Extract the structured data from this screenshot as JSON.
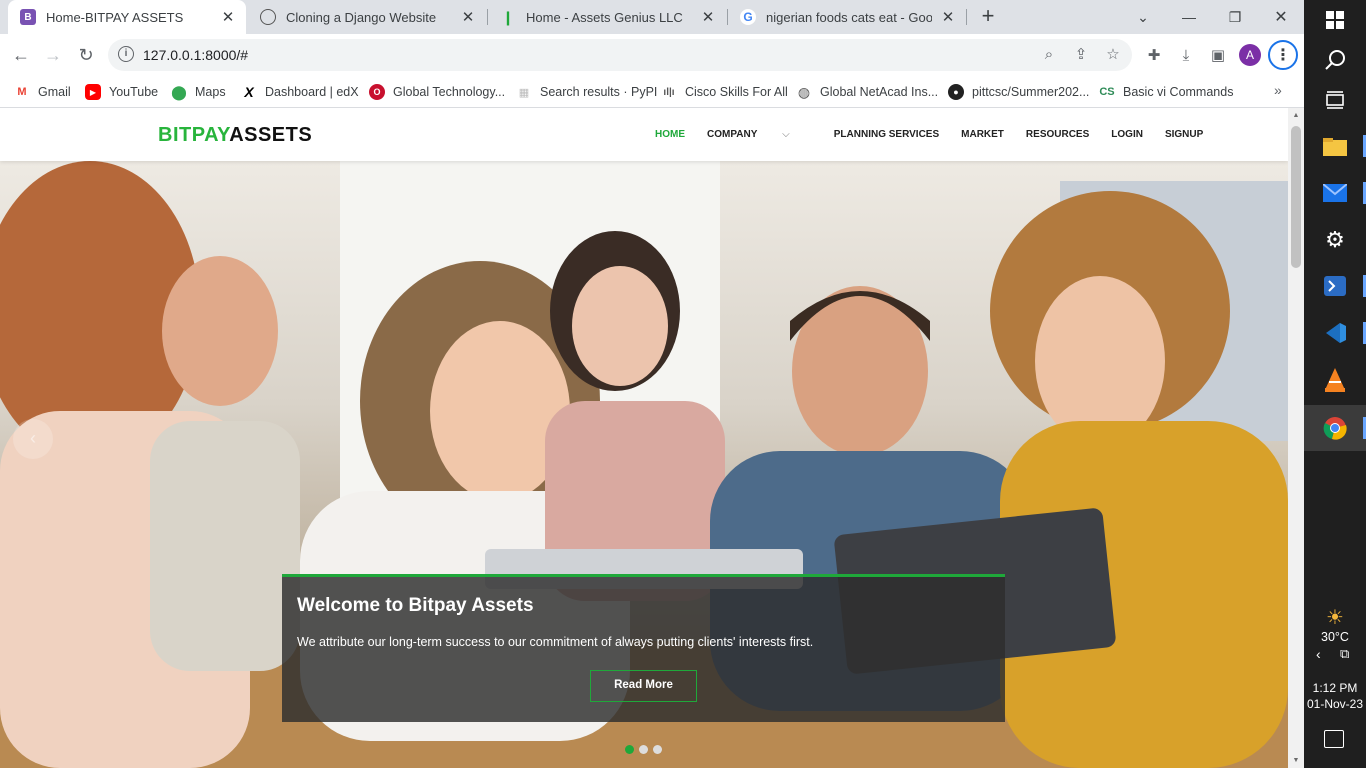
{
  "browser": {
    "tabs": [
      {
        "title": "Home-BITPAY ASSETS",
        "icon": "bootstrap-icon",
        "active": true
      },
      {
        "title": "Cloning a Django Website",
        "icon": "chatgpt-icon",
        "active": false
      },
      {
        "title": "Home - Assets Genius LLC",
        "icon": "green-leaf-icon",
        "active": false
      },
      {
        "title": "nigerian foods cats eat - Google",
        "icon": "google-icon",
        "active": false
      }
    ],
    "url": "127.0.0.1:8000/#",
    "profile_initial": "A",
    "bookmarks": [
      {
        "label": "Gmail",
        "icon": "gmail-icon"
      },
      {
        "label": "YouTube",
        "icon": "youtube-icon"
      },
      {
        "label": "Maps",
        "icon": "maps-icon"
      },
      {
        "label": "Dashboard | edX",
        "icon": "edx-icon"
      },
      {
        "label": "Global Technology...",
        "icon": "opera-icon"
      },
      {
        "label": "Search results · PyPI",
        "icon": "pypi-icon"
      },
      {
        "label": "Cisco Skills For All",
        "icon": "cisco-icon"
      },
      {
        "label": "Global NetAcad Ins...",
        "icon": "globe-icon"
      },
      {
        "label": "pittcsc/Summer202...",
        "icon": "github-icon"
      },
      {
        "label": "Basic vi Commands",
        "icon": "cs-icon"
      }
    ]
  },
  "site": {
    "brand_part1": "BITPAY",
    "brand_part2": "ASSETS",
    "brand_color": "#28b43c",
    "nav": [
      "HOME",
      "COMPANY",
      "PLANNING SERVICES",
      "MARKET",
      "RESOURCES",
      "LOGIN",
      "SIGNUP"
    ],
    "hero": {
      "heading": "Welcome to Bitpay Assets",
      "text": "We attribute our long-term success to our commitment of always putting clients' interests first.",
      "button": "Read More",
      "slides": 3,
      "active_slide": 1
    }
  },
  "taskbar": {
    "weather": "30°C",
    "time": "1:12 PM",
    "date": "01-Nov-23",
    "apps": [
      "windows-start-icon",
      "search-icon",
      "task-view-icon",
      "file-explorer-icon",
      "mail-icon",
      "settings-icon",
      "powershell-icon",
      "vscode-icon",
      "vlc-icon",
      "chrome-icon"
    ]
  }
}
